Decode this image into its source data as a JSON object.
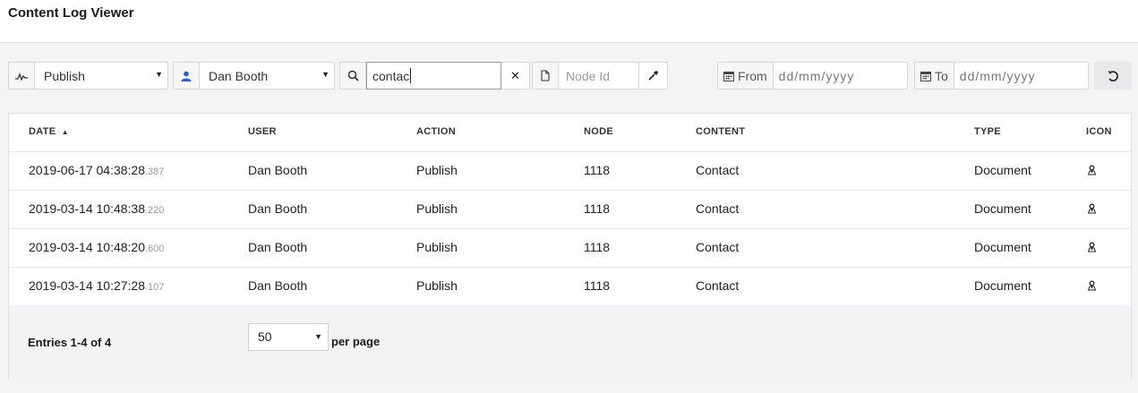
{
  "app": {
    "title": "Content Log Viewer"
  },
  "filters": {
    "action": {
      "selected": "Publish",
      "icon": "activity-icon"
    },
    "user": {
      "selected": "Dan Booth",
      "icon": "user-icon"
    },
    "search": {
      "value": "contac",
      "icon": "search-icon",
      "clear_icon": "clear-icon"
    },
    "node": {
      "placeholder": "Node Id",
      "icon": "document-icon",
      "picker_icon": "eyedropper-icon"
    },
    "from": {
      "label": "From",
      "placeholder": "dd/mm/yyyy",
      "icon": "calendar-icon"
    },
    "to": {
      "label": "To",
      "placeholder": "dd/mm/yyyy",
      "icon": "calendar-icon"
    },
    "reset_icon": "refresh-icon"
  },
  "table": {
    "columns": [
      "DATE",
      "USER",
      "ACTION",
      "NODE",
      "CONTENT",
      "TYPE",
      "ICON"
    ],
    "sort": {
      "column": "DATE",
      "direction": "asc"
    },
    "rows": [
      {
        "date": "2019-06-17 04:38:28",
        "ms": ".387",
        "user": "Dan Booth",
        "action": "Publish",
        "node": "1118",
        "content": "Contact",
        "type": "Document",
        "icon": "document-pin-icon"
      },
      {
        "date": "2019-03-14 10:48:38",
        "ms": ".220",
        "user": "Dan Booth",
        "action": "Publish",
        "node": "1118",
        "content": "Contact",
        "type": "Document",
        "icon": "document-pin-icon"
      },
      {
        "date": "2019-03-14 10:48:20",
        "ms": ".600",
        "user": "Dan Booth",
        "action": "Publish",
        "node": "1118",
        "content": "Contact",
        "type": "Document",
        "icon": "document-pin-icon"
      },
      {
        "date": "2019-03-14 10:27:28",
        "ms": ".107",
        "user": "Dan Booth",
        "action": "Publish",
        "node": "1118",
        "content": "Contact",
        "type": "Document",
        "icon": "document-pin-icon"
      }
    ]
  },
  "footer": {
    "entries": "Entries 1-4 of 4",
    "per_page_value": "50",
    "per_page_label": "per page"
  }
}
